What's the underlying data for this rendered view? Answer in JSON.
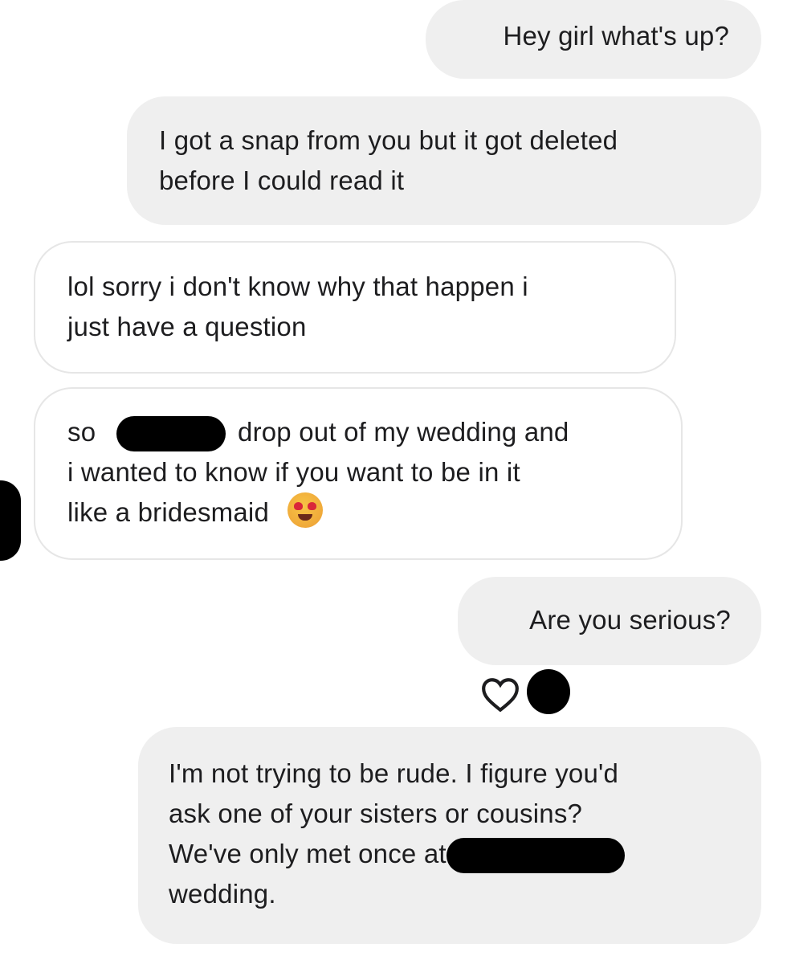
{
  "conversation": {
    "messages": [
      {
        "direction": "outgoing",
        "lines": [
          "Hey girl what's up?"
        ]
      },
      {
        "direction": "outgoing",
        "lines": [
          "I got a snap from you but it got deleted",
          "before I could read it"
        ]
      },
      {
        "direction": "incoming",
        "lines": [
          "lol sorry i don't know why that happen i",
          "just have a question"
        ]
      },
      {
        "direction": "incoming",
        "line1_before": "so",
        "line1_after": "drop out of my wedding and",
        "line2": "i wanted to know if you want to be in it",
        "line3": "like a bridesmaid",
        "emoji": "heart-eyes-emoji"
      },
      {
        "direction": "outgoing",
        "lines": [
          "Are you serious?"
        ],
        "reaction_icon": "heart-outline-icon"
      },
      {
        "direction": "outgoing",
        "line1": "I'm not trying to be rude. I figure you'd",
        "line2": "ask one of your sisters or cousins?",
        "line3_before": "We've only met once at",
        "line4": "wedding."
      }
    ]
  },
  "colors": {
    "outgoing_bubble": "#efefef",
    "incoming_bubble": "#ffffff",
    "incoming_border": "#e6e6e6",
    "text": "#1d1d1f",
    "redaction": "#000000"
  }
}
